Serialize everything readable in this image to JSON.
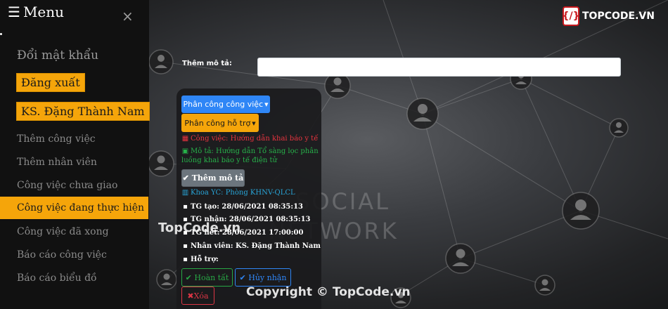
{
  "sidebar": {
    "title": "Menu",
    "hamburger_glyph": "☰",
    "close_glyph": "×",
    "change_password": "Đổi mật khẩu",
    "logout": "Đăng xuất",
    "user_name": "KS. Đặng Thành Nam",
    "items": [
      {
        "label": "Thêm công việc"
      },
      {
        "label": "Thêm nhân viên"
      },
      {
        "label": "Công việc chưa giao"
      },
      {
        "label": "Công việc đang thực hiện",
        "active": true
      },
      {
        "label": "Công việc đã xong"
      },
      {
        "label": "Báo cáo công việc"
      },
      {
        "label": "Báo cáo biểu đồ"
      }
    ]
  },
  "logo": {
    "text": "TOPCODE.VN",
    "mark": "{/}"
  },
  "form": {
    "description_label": "Thêm mô tả:",
    "description_value": ""
  },
  "task": {
    "assign_button": "Phân công công việc",
    "support_button": "Phân công hỗ trợ",
    "job": "Công việc: Hướng dẫn khai báo y tế",
    "description_line1": "Mô tả: Hướng dẫn Tổ sàng lọc phân",
    "description_line2": "luồng khai báo y tế điện tử",
    "add_desc_button": "Thêm mô tả",
    "department": "Khoa YC: Phòng KHNV-QLCL",
    "created": "TG tạo: 28/06/2021 08:35:13",
    "received": "TG nhận: 28/06/2021 08:35:13",
    "deadline": "TG hết: 28/06/2021 17:00:00",
    "staff": "Nhân viên: KS. Đặng Thành Nam",
    "support": "Hỗ trợ:",
    "complete_button": "Hoàn tất",
    "cancel_button": "Hủy nhận",
    "delete_button": "Xóa"
  },
  "background": {
    "line1": "SOCIAL",
    "line2": "NETWORK"
  },
  "watermarks": {
    "brand": "TopCode.vn",
    "copyright": "Copyright © TopCode.vn"
  },
  "colors": {
    "accent_orange": "#f5a50a",
    "primary_blue": "#2f86f6",
    "danger_red": "#dc3545",
    "success_green": "#28a745",
    "info_cyan": "#28a5d8"
  }
}
